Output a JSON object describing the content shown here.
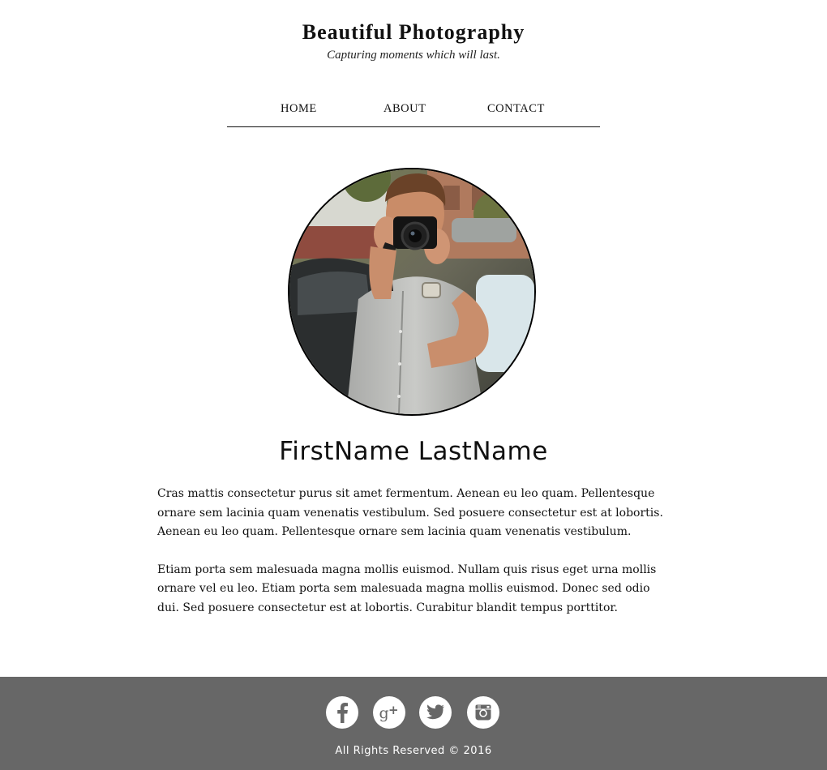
{
  "header": {
    "title": "Beautiful Photography",
    "tagline": "Capturing moments which will last."
  },
  "nav": {
    "items": [
      {
        "label": "HOME"
      },
      {
        "label": "ABOUT"
      },
      {
        "label": "CONTACT"
      }
    ]
  },
  "profile": {
    "photo_icon": "photographer-portrait",
    "name": "FirstName LastName",
    "bio": [
      "Cras mattis consectetur purus sit amet fermentum. Aenean eu leo quam. Pellentesque ornare sem lacinia quam venenatis vestibulum. Sed posuere consectetur est at lobortis. Aenean eu leo quam. Pellentesque ornare sem lacinia quam venenatis vestibulum.",
      "Etiam porta sem malesuada magna mollis euismod. Nullam quis risus eget urna mollis ornare vel eu leo. Etiam porta sem malesuada magna mollis euismod. Donec sed odio dui. Sed posuere consectetur est at lobortis. Curabitur blandit tempus porttitor."
    ]
  },
  "footer": {
    "social": [
      {
        "icon": "facebook-icon"
      },
      {
        "icon": "google-plus-icon"
      },
      {
        "icon": "twitter-icon"
      },
      {
        "icon": "instagram-icon"
      }
    ],
    "copyright": "All Rights Reserved © 2016",
    "background_color": "#676767"
  }
}
